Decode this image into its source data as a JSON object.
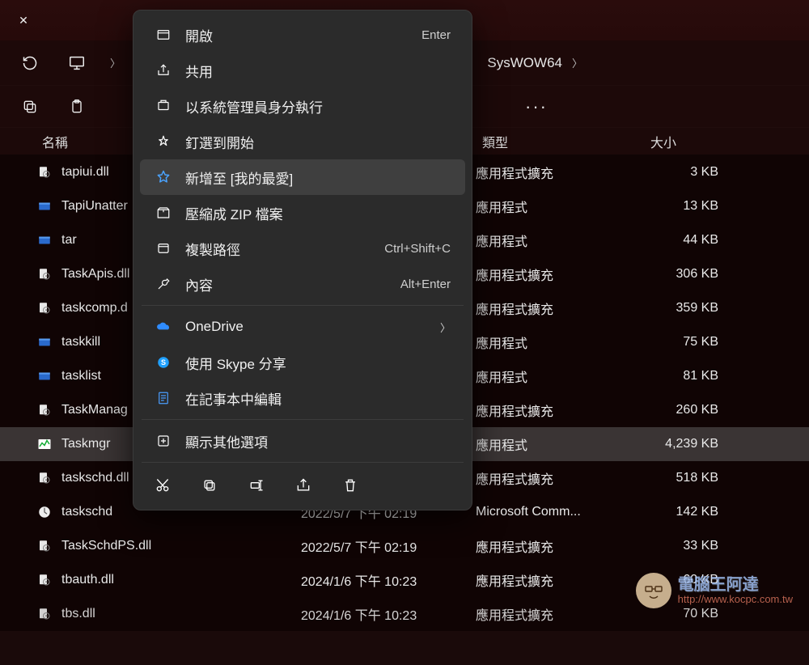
{
  "tab": {
    "close": "✕"
  },
  "breadcrumb": {
    "segment": "SysWOW64"
  },
  "columns": {
    "name": "名稱",
    "type": "類型",
    "size": "大小"
  },
  "files": [
    {
      "name": "tapiui.dll",
      "date": "",
      "type": "應用程式擴充",
      "size": "3 KB",
      "icon": "dll"
    },
    {
      "name": "TapiUnatter",
      "date": "",
      "type": "應用程式",
      "size": "13 KB",
      "icon": "exe"
    },
    {
      "name": "tar",
      "date": "",
      "type": "應用程式",
      "size": "44 KB",
      "icon": "exe"
    },
    {
      "name": "TaskApis.dll",
      "date": "",
      "type": "應用程式擴充",
      "size": "306 KB",
      "icon": "dll"
    },
    {
      "name": "taskcomp.d",
      "date": "",
      "type": "應用程式擴充",
      "size": "359 KB",
      "icon": "dll"
    },
    {
      "name": "taskkill",
      "date": "",
      "type": "應用程式",
      "size": "75 KB",
      "icon": "exe"
    },
    {
      "name": "tasklist",
      "date": "",
      "type": "應用程式",
      "size": "81 KB",
      "icon": "exe"
    },
    {
      "name": "TaskManag",
      "date": "",
      "type": "應用程式擴充",
      "size": "260 KB",
      "icon": "dll"
    },
    {
      "name": "Taskmgr",
      "date": "",
      "type": "應用程式",
      "size": "4,239 KB",
      "icon": "taskmgr",
      "selected": true
    },
    {
      "name": "taskschd.dll",
      "date": "",
      "type": "應用程式擴充",
      "size": "518 KB",
      "icon": "dll"
    },
    {
      "name": "taskschd",
      "date": "2022/5/7 下午 02:19",
      "type": "Microsoft Comm...",
      "size": "142 KB",
      "icon": "msc"
    },
    {
      "name": "TaskSchdPS.dll",
      "date": "2022/5/7 下午 02:19",
      "type": "應用程式擴充",
      "size": "33 KB",
      "icon": "dll"
    },
    {
      "name": "tbauth.dll",
      "date": "2024/1/6 下午 10:23",
      "type": "應用程式擴充",
      "size": "60 KB",
      "icon": "dll"
    },
    {
      "name": "tbs.dll",
      "date": "2024/1/6 下午 10:23",
      "type": "應用程式擴充",
      "size": "70 KB",
      "icon": "dll"
    }
  ],
  "menu": {
    "open": {
      "label": "開啟",
      "shortcut": "Enter"
    },
    "share": {
      "label": "共用"
    },
    "runas": {
      "label": "以系統管理員身分執行"
    },
    "pin_start": {
      "label": "釘選到開始"
    },
    "add_fav": {
      "label": "新增至 [我的最愛]"
    },
    "zip": {
      "label": "壓縮成 ZIP 檔案"
    },
    "copy_path": {
      "label": "複製路徑",
      "shortcut": "Ctrl+Shift+C"
    },
    "properties": {
      "label": "內容",
      "shortcut": "Alt+Enter"
    },
    "onedrive": {
      "label": "OneDrive"
    },
    "skype": {
      "label": "使用 Skype 分享"
    },
    "notepad": {
      "label": "在記事本中編輯"
    },
    "more": {
      "label": "顯示其他選項"
    }
  },
  "watermark": {
    "line1": "電腦王阿達",
    "line2": "http://www.kocpc.com.tw"
  }
}
